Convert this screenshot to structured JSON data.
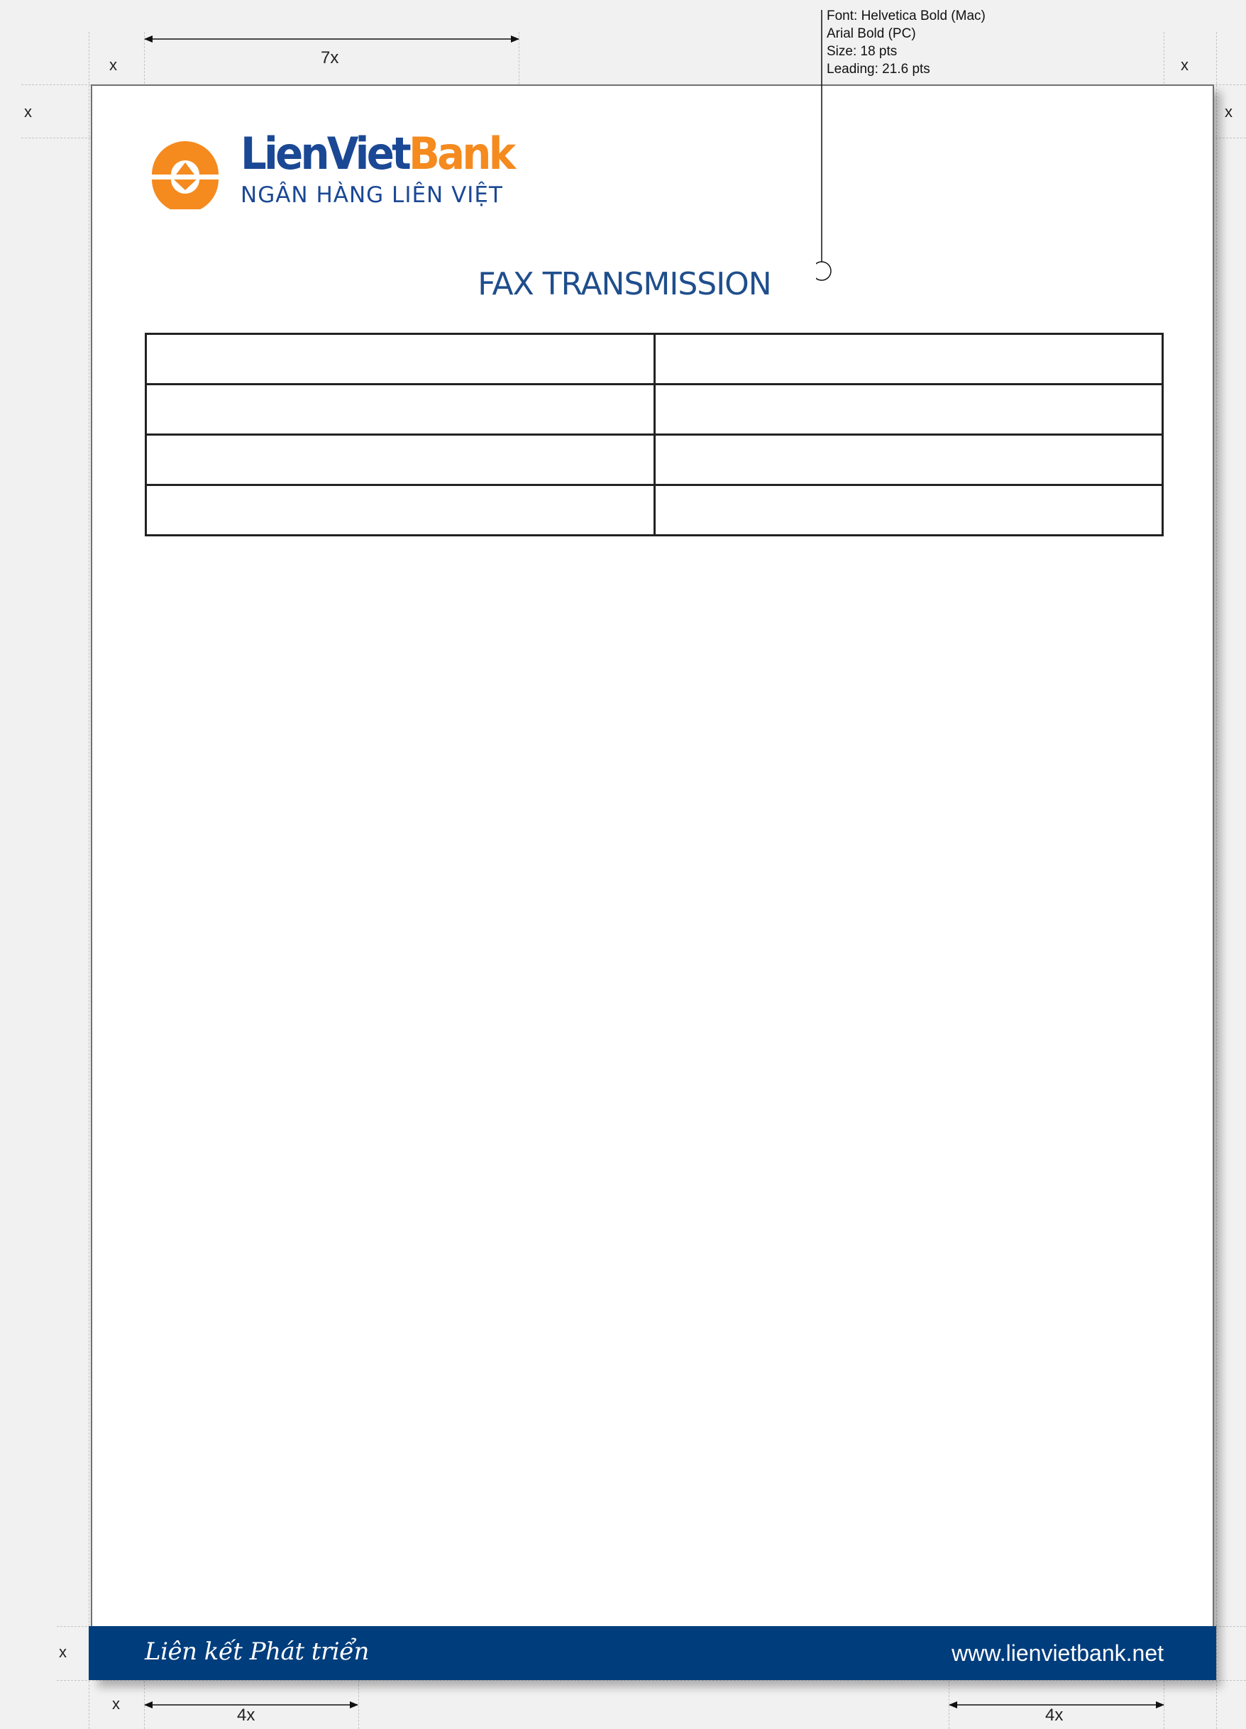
{
  "spec": {
    "lines": [
      "Font: Helvetica Bold (Mac)",
      "Arial Bold (PC)",
      "Size: 18 pts",
      "Leading: 21.6 pts"
    ]
  },
  "dimensions": {
    "x_label": "x",
    "logo_width_label": "7x",
    "footer_margin_label": "4x"
  },
  "logo": {
    "name_part1": "LienViet",
    "name_part2": "Bank",
    "subtitle": "NGÂN HÀNG LIÊN VIỆT",
    "colors": {
      "blue": "#1a4894",
      "orange": "#f58a1f"
    }
  },
  "document": {
    "title": "FAX TRANSMISSION",
    "table": {
      "rows": [
        [
          "",
          ""
        ],
        [
          "",
          ""
        ],
        [
          "",
          ""
        ],
        [
          "",
          ""
        ]
      ]
    }
  },
  "footer": {
    "slogan": "Liên kết Phát triển",
    "url": "www.lienvietbank.net",
    "background": "#003d7c"
  }
}
